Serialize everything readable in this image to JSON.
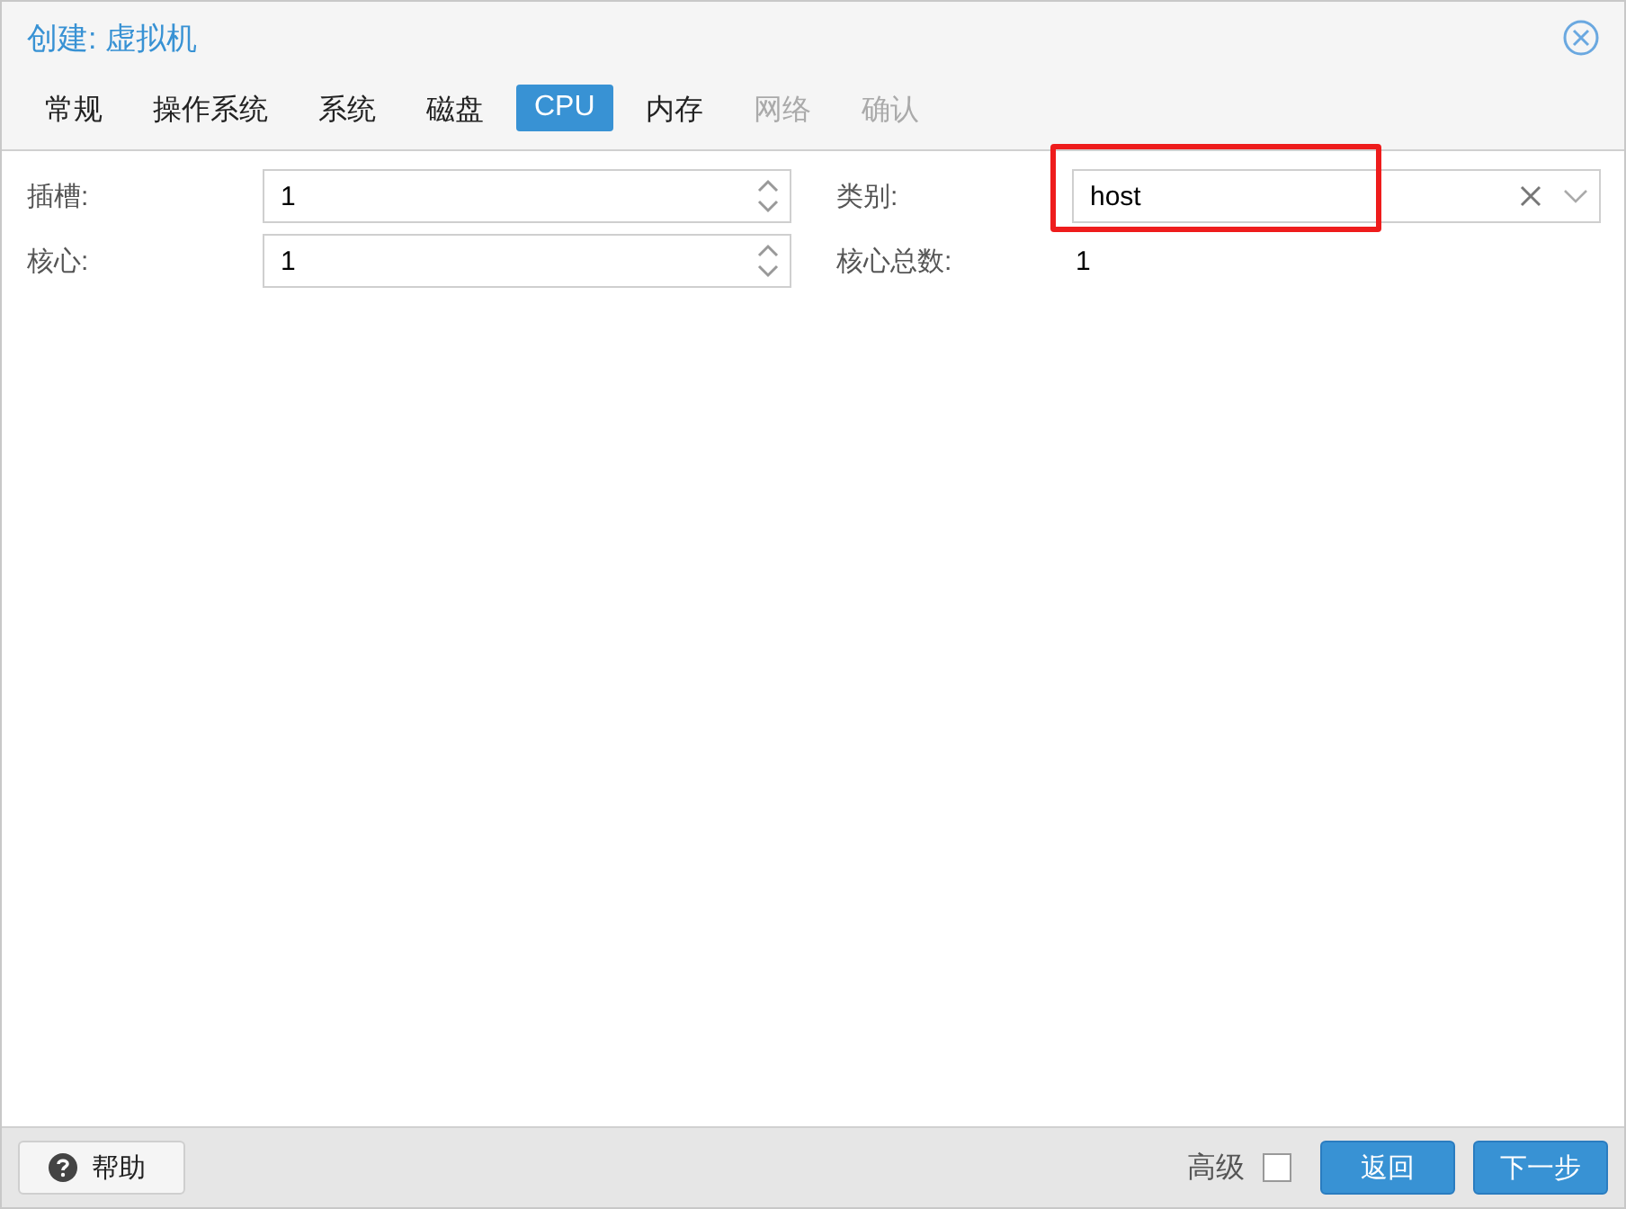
{
  "window": {
    "title": "创建: 虚拟机"
  },
  "tabs": [
    {
      "label": "常规",
      "selected": false,
      "disabled": false
    },
    {
      "label": "操作系统",
      "selected": false,
      "disabled": false
    },
    {
      "label": "系统",
      "selected": false,
      "disabled": false
    },
    {
      "label": "磁盘",
      "selected": false,
      "disabled": false
    },
    {
      "label": "CPU",
      "selected": true,
      "disabled": false
    },
    {
      "label": "内存",
      "selected": false,
      "disabled": false
    },
    {
      "label": "网络",
      "selected": false,
      "disabled": true
    },
    {
      "label": "确认",
      "selected": false,
      "disabled": true
    }
  ],
  "left_fields": [
    {
      "label": "插槽:",
      "value": "1"
    },
    {
      "label": "核心:",
      "value": "1"
    }
  ],
  "type_field": {
    "label": "类别:",
    "value": "host",
    "highlighted": true
  },
  "total_cores": {
    "label": "核心总数:",
    "value": "1"
  },
  "footer": {
    "help": "帮助",
    "advanced": {
      "label": "高级",
      "checked": false
    },
    "back": "返回",
    "next": "下一步"
  }
}
